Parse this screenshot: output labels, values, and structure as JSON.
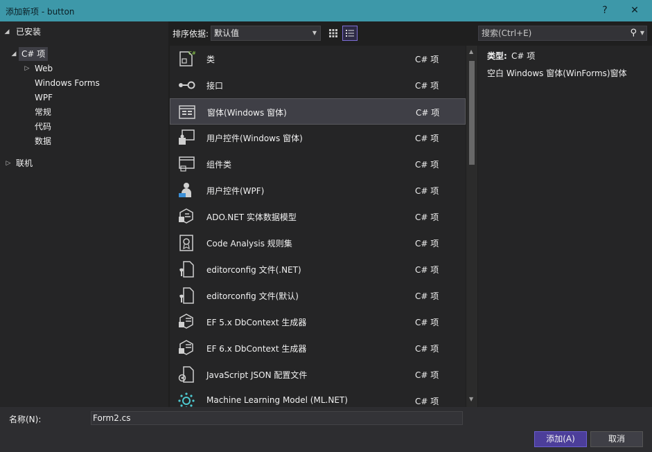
{
  "window": {
    "title": "添加新项 - button",
    "help": "?",
    "close": "✕"
  },
  "tree": {
    "installed": "已安装",
    "csharp": "C# 项",
    "web": "Web",
    "winforms": "Windows Forms",
    "wpf": "WPF",
    "general": "常规",
    "code": "代码",
    "data": "数据",
    "online": "联机"
  },
  "toolbar": {
    "sort_label": "排序依据:",
    "sort_value": "默认值"
  },
  "search": {
    "placeholder": "搜索(Ctrl+E)"
  },
  "items": [
    {
      "name": "类",
      "lang": "C# 项",
      "icon": "class-icon"
    },
    {
      "name": "接口",
      "lang": "C# 项",
      "icon": "interface-icon"
    },
    {
      "name": "窗体(Windows 窗体)",
      "lang": "C# 项",
      "icon": "windows-form-icon",
      "selected": true
    },
    {
      "name": "用户控件(Windows 窗体)",
      "lang": "C# 项",
      "icon": "user-control-icon"
    },
    {
      "name": "组件类",
      "lang": "C# 项",
      "icon": "component-class-icon"
    },
    {
      "name": "用户控件(WPF)",
      "lang": "C# 项",
      "icon": "wpf-user-control-icon"
    },
    {
      "name": "ADO.NET 实体数据模型",
      "lang": "C# 项",
      "icon": "entity-model-icon"
    },
    {
      "name": "Code Analysis 规则集",
      "lang": "C# 项",
      "icon": "ruleset-icon"
    },
    {
      "name": "editorconfig 文件(.NET)",
      "lang": "C# 项",
      "icon": "editorconfig-icon"
    },
    {
      "name": "editorconfig 文件(默认)",
      "lang": "C# 项",
      "icon": "editorconfig-icon"
    },
    {
      "name": "EF 5.x DbContext 生成器",
      "lang": "C# 项",
      "icon": "dbcontext-generator-icon"
    },
    {
      "name": "EF 6.x DbContext 生成器",
      "lang": "C# 项",
      "icon": "dbcontext-generator-icon"
    },
    {
      "name": "JavaScript JSON 配置文件",
      "lang": "C# 项",
      "icon": "json-config-icon"
    },
    {
      "name": "Machine Learning Model (ML.NET)",
      "lang": "C# 项",
      "icon": "ml-model-icon"
    }
  ],
  "details": {
    "type_label": "类型:",
    "type_value": "C# 项",
    "description": "空白 Windows 窗体(WinForms)窗体"
  },
  "bottom": {
    "name_label": "名称(N):",
    "name_value": "Form2.cs",
    "add_button": "添加(A)",
    "cancel_button": "取消"
  },
  "colors": {
    "titlebar": "#3d98a9",
    "accent": "#4c3e9a",
    "background": "#1f1f1f",
    "panel": "#252526"
  }
}
